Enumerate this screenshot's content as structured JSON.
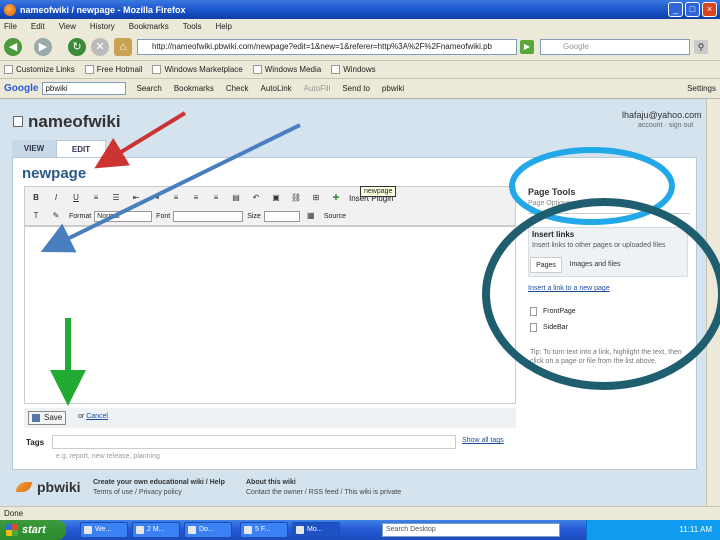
{
  "window": {
    "title": "nameofwiki / newpage - Mozilla Firefox",
    "minimize": "_",
    "maximize": "□",
    "close": "×"
  },
  "menu": [
    "File",
    "Edit",
    "View",
    "History",
    "Bookmarks",
    "Tools",
    "Help"
  ],
  "nav": {
    "url": "http://nameofwiki.pbwiki.com/newpage?edit=1&new=1&referer=http%3A%2F%2Fnameofwiki.pb",
    "search_placeholder": "Google"
  },
  "bookmarks": [
    "Customize Links",
    "Free Hotmail",
    "Windows Marketplace",
    "Windows Media",
    "Windows"
  ],
  "google_toolbar": {
    "logo": "Google",
    "query": "pbwiki",
    "items": [
      "Search",
      "Bookmarks",
      "Check",
      "AutoLink",
      "AutoFill",
      "Send to",
      "pbwiki"
    ],
    "settings": "Settings"
  },
  "wiki": {
    "name": "nameofwiki",
    "user_email": "lhafaju@yahoo.com",
    "user_links": "account · sign out",
    "tabs": {
      "view": "VIEW",
      "edit": "EDIT"
    },
    "page_title": "newpage"
  },
  "editor": {
    "tooltip": "newpage",
    "insert_plugin": "Insert Plugin",
    "format_label": "Format",
    "format_value": "Normal",
    "font_label": "Font",
    "size_label": "Size",
    "source_label": "Source",
    "save_label": "Save",
    "cancel_prefix": "or",
    "cancel_label": "Cancel"
  },
  "tags": {
    "label": "Tags",
    "show_all": "Show all tags",
    "hint": "e.g. report, new release, planning"
  },
  "sidebar": {
    "page_tools": "Page Tools",
    "page_tools_sub": "Page Options",
    "insert_links_title": "Insert links",
    "insert_links_desc": "Insert links to other pages or uploaded files",
    "subtabs": {
      "pages": "Pages",
      "images": "Images and files"
    },
    "new_page_link": "Insert a link to a new page",
    "pages": [
      "FrontPage",
      "SideBar"
    ],
    "tip": "Tip: To turn text into a link, highlight the text, then click on a page or file from the list above."
  },
  "footer": {
    "logo": "pbwiki",
    "col1_title": "Create your own educational wiki / Help",
    "col1_links": "Terms of use / Privacy policy",
    "col2_title": "About this wiki",
    "col2_links": "Contact the owner / RSS feed / This wiki is private"
  },
  "status": "Done",
  "taskbar": {
    "start": "start",
    "tasks": [
      "We...",
      "2 M...",
      "Do...",
      "5 F...",
      "Mo..."
    ],
    "search": "Search Desktop",
    "clock": "11:11 AM"
  },
  "annotations": {
    "arrow_red_color": "#cc3333",
    "arrow_blue_color": "#4a7fbf",
    "arrow_green_color": "#22aa33",
    "circle_light_color": "#22a8e8",
    "circle_dark_color": "#1f5e6e"
  }
}
